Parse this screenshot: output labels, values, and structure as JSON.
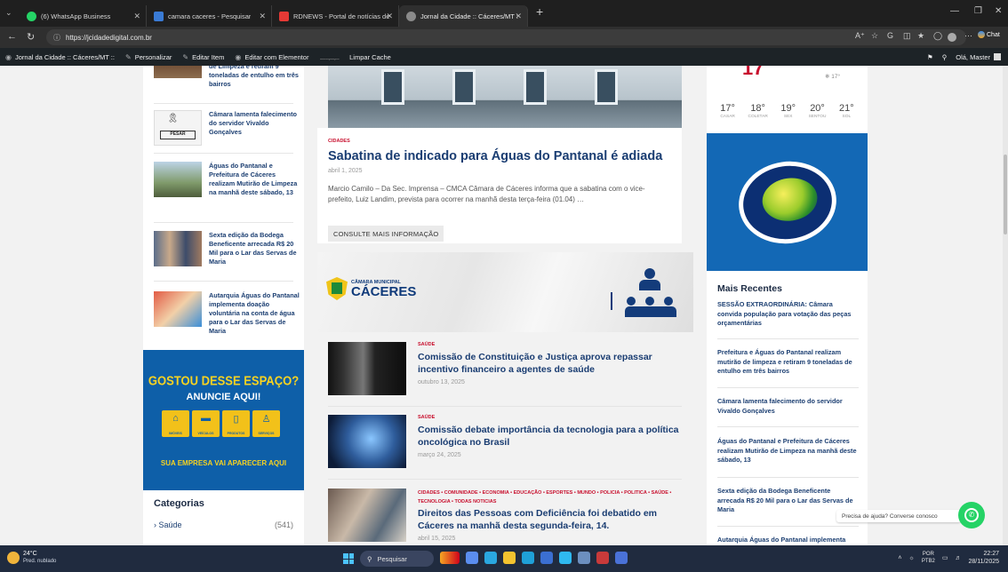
{
  "browser": {
    "tabs": [
      {
        "label": "(6) WhatsApp Business",
        "color": "#25d366"
      },
      {
        "label": "camara caceres - Pesquisar",
        "color": "#3a7bd5"
      },
      {
        "label": "RDNEWS - Portal de notícias de M",
        "color": "#e53935"
      },
      {
        "label": "Jornal da Cidade :: Cáceres/MT :: -",
        "color": "#888888"
      }
    ],
    "url": "https://jcidadedigital.com.br",
    "reader_label": "Aᴬ",
    "chat_label": "Chat"
  },
  "admin_bar": {
    "site": "Jornal da Cidade :: Cáceres/MT ::",
    "customize": "Personalizar",
    "edit_item": "Editar Item",
    "edit_elementor": "Editar com Elementor",
    "clear_cache": "Limpar Cache",
    "greeting": "Olá, Master"
  },
  "left_sidebar": {
    "items": [
      {
        "title": "de Limpeza e retiram 9 toneladas de entulho em três bairros"
      },
      {
        "title": "Câmara lamenta falecimento do servidor Vivaldo Gonçalves"
      },
      {
        "title": "Águas do Pantanal e Prefeitura de Cáceres realizam Mutirão de Limpeza na manhã deste sábado, 13"
      },
      {
        "title": "Sexta edição da Bodega Beneficente arrecada R$ 20 Mil para o Lar das Servas de Maria"
      },
      {
        "title": "Autarquia Águas do Pantanal implementa doação voluntária na conta de água para o Lar das Servas de Maria"
      }
    ],
    "ad": {
      "headline": "GOSTOU DESSE ESPAÇO?",
      "subheadline": "ANUNCIE AQUI!",
      "icons": [
        {
          "icon": "house-icon",
          "glyph": "⌂",
          "label": "IMÓVEIS"
        },
        {
          "icon": "car-icon",
          "glyph": "▬",
          "label": "VEÍCULOS"
        },
        {
          "icon": "phone-icon",
          "glyph": "▯",
          "label": "PRODUTOS"
        },
        {
          "icon": "people-icon",
          "glyph": "♙",
          "label": "SERVIÇOS"
        }
      ],
      "footer": "SUA EMPRESA VAI APARECER AQUI"
    },
    "categories": {
      "heading": "Categorias",
      "items": [
        {
          "label": "Saúde",
          "count": "(541)"
        }
      ]
    }
  },
  "main": {
    "featured": {
      "category": "CIDADES",
      "title": "Sabatina de indicado para Águas do Pantanal é adiada",
      "date": "abril 1, 2025",
      "excerpt": "Marcio Camilo – Da Sec. Imprensa – CMCA  Câmara de Cáceres informa que a sabatina com o vice-prefeito, Luiz Landim, prevista para ocorrer na manhã desta terça-feira (01.04) …",
      "more": "CONSULTE MAIS INFORMAÇÃO"
    },
    "banner": {
      "small": "CÂMARA MUNICIPAL",
      "big": "CÁCERES"
    },
    "posts": [
      {
        "category": "SAÚDE",
        "title": "Comissão de Constituição e Justiça aprova repassar incentivo financeiro a agentes de saúde",
        "date": "outubro 13, 2025"
      },
      {
        "category": "SAÚDE",
        "title": "Comissão debate importância da tecnologia para a política oncológica no Brasil",
        "date": "março 24, 2025"
      },
      {
        "category": "CIDADES  •  COMUNIDADE  •  ECONOMIA  •  EDUCAÇÃO  •  ESPORTES  •  MUNDO  •  POLICIA  •  POLITICA  •  SAÚDE  •  TECNOLOGIA  •  TODAS NOTICIAS",
        "title": "Direitos das Pessoas com Deficiência foi debatido em Cáceres na manhã desta segunda-feira, 14.",
        "date": "abril 15, 2025"
      }
    ]
  },
  "right_sidebar": {
    "weather": {
      "current": "17",
      "small": "❄ 17°",
      "days": [
        {
          "temp": "17°",
          "day": "CASAR"
        },
        {
          "temp": "18°",
          "day": "COLETAR"
        },
        {
          "temp": "19°",
          "day": "SEX"
        },
        {
          "temp": "20°",
          "day": "SENTOU"
        },
        {
          "temp": "21°",
          "day": "SOL"
        }
      ]
    },
    "recent": {
      "heading": "Mais Recentes",
      "items": [
        "SESSÃO EXTRAORDINÁRIA: Câmara convida população para votação das peças orçamentárias",
        "Prefeitura e Águas do Pantanal realizam mutirão de limpeza e retiram 9 toneladas de entulho em três bairros",
        "Câmara lamenta falecimento do servidor Vivaldo Gonçalves",
        "Águas do Pantanal e Prefeitura de Cáceres realizam Mutirão de Limpeza na manhã deste sábado, 13",
        "Sexta edição da Bodega Beneficente arrecada R$ 20 Mil para o Lar das Servas de Maria",
        "Autarquia Águas do Pantanal implementa"
      ]
    }
  },
  "chat_widget": {
    "tooltip": "Precisa de ajuda? Converse conosco"
  },
  "taskbar": {
    "weather_temp": "24°C",
    "weather_desc": "Pred. nublado",
    "search": "Pesquisar",
    "lang1": "POR",
    "lang2": "PTB2",
    "time": "22:27",
    "date": "28/11/2025"
  }
}
